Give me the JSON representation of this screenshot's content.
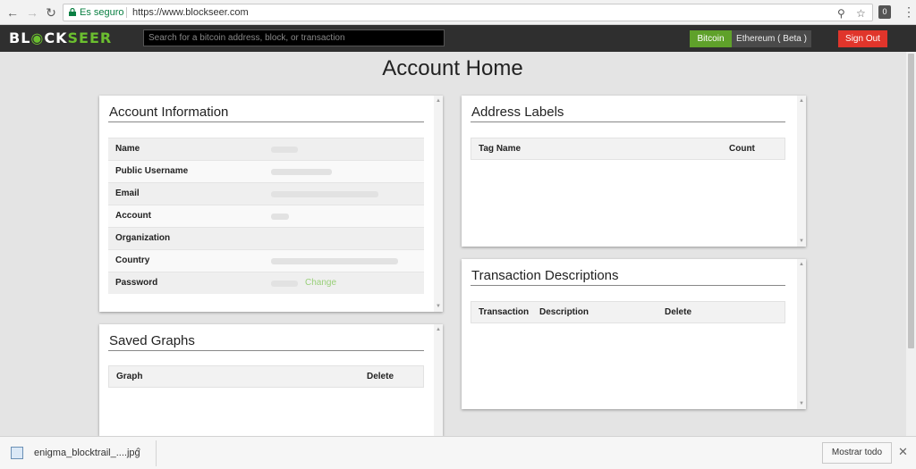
{
  "browser": {
    "secure_label": "Es seguro",
    "url": "https://www.blockseer.com"
  },
  "header": {
    "logo_part1": "BL",
    "logo_part2": "CK",
    "logo_part3": "SEER",
    "search_placeholder": "Search for a bitcoin address, block, or transaction",
    "bitcoin_label": "Bitcoin",
    "ethereum_label": "Ethereum ( Beta )",
    "signout_label": "Sign Out"
  },
  "page": {
    "title": "Account Home"
  },
  "account_info": {
    "title": "Account Information",
    "rows": [
      {
        "label": "Name"
      },
      {
        "label": "Public Username"
      },
      {
        "label": "Email"
      },
      {
        "label": "Account"
      },
      {
        "label": "Organization"
      },
      {
        "label": "Country"
      },
      {
        "label": "Password"
      }
    ],
    "change_label": "Change"
  },
  "saved_graphs": {
    "title": "Saved Graphs",
    "col_graph": "Graph",
    "col_delete": "Delete"
  },
  "address_labels": {
    "title": "Address Labels",
    "col_tag": "Tag Name",
    "col_count": "Count"
  },
  "tx_descriptions": {
    "title": "Transaction Descriptions",
    "col_tx": "Transaction",
    "col_desc": "Description",
    "col_delete": "Delete"
  },
  "download_bar": {
    "filename": "enigma_blocktrail_....jpg",
    "show_all": "Mostrar todo"
  },
  "colors": {
    "accent_green": "#5fa12a",
    "signout_red": "#e0352b",
    "header_bg": "#2f2f2f"
  }
}
